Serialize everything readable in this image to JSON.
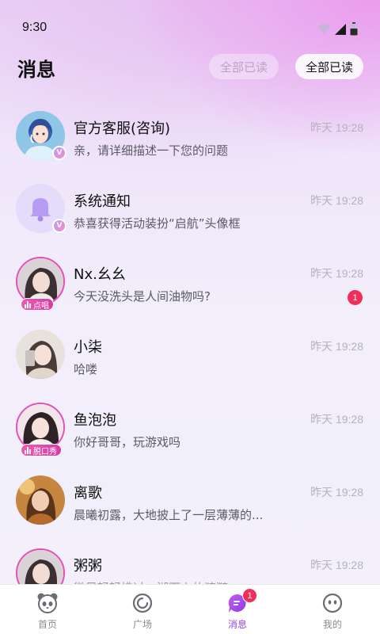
{
  "status_bar": {
    "time": "9:30",
    "icons": [
      "wifi-icon",
      "signal-icon",
      "battery-icon"
    ]
  },
  "header": {
    "title": "消息",
    "mark_all_read_faded": "全部已读",
    "mark_all_read": "全部已读"
  },
  "messages": [
    {
      "name": "官方客服(咨询)",
      "preview": "亲，请详细描述一下您的问题",
      "time": "昨天 19:28",
      "avatar": "support-avatar",
      "verified": "V"
    },
    {
      "name": "系统通知",
      "preview": "恭喜获得活动装扮“启航”头像框",
      "time": "昨天 19:28",
      "avatar": "bell-icon",
      "verified": "V"
    },
    {
      "name": "Nx.幺幺",
      "preview": "今天没洗头是人间油物吗?",
      "time": "昨天 19:28",
      "avatar": "user-avatar",
      "tag": "点唱",
      "unread": "1"
    },
    {
      "name": "小柒",
      "preview": "哈喽",
      "time": "昨天 19:28",
      "avatar": "user-avatar"
    },
    {
      "name": "鱼泡泡",
      "preview": "你好哥哥，玩游戏吗",
      "time": "昨天 19:28",
      "avatar": "user-avatar",
      "tag": "脱口秀"
    },
    {
      "name": "离歌",
      "preview": "晨曦初露，大地披上了一层薄薄的...",
      "time": "昨天 19:28",
      "avatar": "user-avatar"
    },
    {
      "name": "粥粥",
      "preview": "微风轻轻拂过，湖面上的涟漪...",
      "time": "昨天 19:28",
      "avatar": "user-avatar"
    }
  ],
  "tabbar": {
    "home": "首页",
    "square": "广场",
    "messages": "消息",
    "messages_badge": "1",
    "mine": "我的"
  },
  "colors": {
    "accent": "#9b3fe8",
    "badge": "#f1305a",
    "ring": "#e44fb8"
  }
}
